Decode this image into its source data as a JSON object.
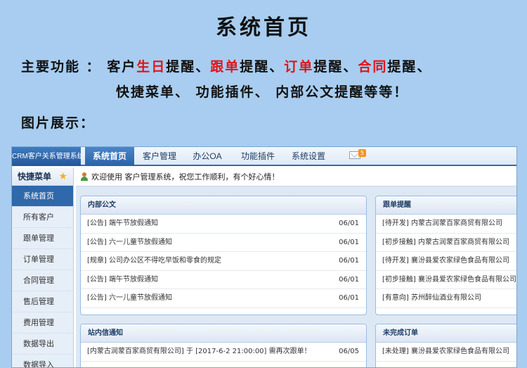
{
  "banner": {
    "title": "系统首页",
    "features_line1": [
      {
        "text": "主要功能 ： 客户",
        "red": false
      },
      {
        "text": "生日",
        "red": true
      },
      {
        "text": "提醒、",
        "red": false
      },
      {
        "text": "跟单",
        "red": true
      },
      {
        "text": "提醒、",
        "red": false
      },
      {
        "text": "订单",
        "red": true
      },
      {
        "text": "提醒、",
        "red": false
      },
      {
        "text": "合同",
        "red": true
      },
      {
        "text": "提醒、",
        "red": false
      }
    ],
    "features_line2": "快捷菜单、 功能插件、 内部公文提醒等等！",
    "showcase": "图片展示："
  },
  "app": {
    "system_name": "CRM客户关系管理系统",
    "tabs": [
      "系统首页",
      "客户管理",
      "办公OA",
      "功能插件",
      "系统设置"
    ],
    "active_tab": 0,
    "mail_count": "5",
    "sidebar": {
      "header": "快捷菜单",
      "items": [
        "系统首页",
        "所有客户",
        "跟单管理",
        "订单管理",
        "合同管理",
        "售后管理",
        "费用管理",
        "数据导出",
        "数据导入"
      ]
    },
    "welcome": "欢迎使用 客户管理系统，祝您工作顺利，有个好心情！",
    "panels": {
      "internal_docs": {
        "title": "内部公文",
        "rows": [
          {
            "text": "[公告] 端午节放假通知",
            "date": "06/01"
          },
          {
            "text": "[公告] 六一儿童节放假通知",
            "date": "06/01"
          },
          {
            "text": "[规章] 公司办公区不得吃早饭和零食的规定",
            "date": "06/01"
          },
          {
            "text": "[公告] 端午节放假通知",
            "date": "06/01"
          },
          {
            "text": "[公告] 六一儿童节放假通知",
            "date": "06/01"
          }
        ]
      },
      "followup": {
        "title": "跟单提醒",
        "rows": [
          "[待开发] 内蒙古润蒙百家商贸有限公司",
          "[初步接触] 内蒙古润蒙百家商贸有限公司",
          "[待开发] 襄汾县爱农家绿色食品有限公司",
          "[初步接触] 襄汾县爱农家绿色食品有限公司",
          "[有意向] 苏州醉仙酒业有限公司"
        ]
      },
      "messages": {
        "title": "站内信通知",
        "rows": [
          {
            "text": "[内蒙古润蒙百家商贸有限公司] 于 [2017-6-2 21:00:00] 需再次跟单！",
            "date": "06/05"
          }
        ]
      },
      "pending_orders": {
        "title": "未完成订单",
        "rows": [
          "[未处理] 襄汾县爱农家绿色食品有限公司"
        ]
      }
    }
  }
}
